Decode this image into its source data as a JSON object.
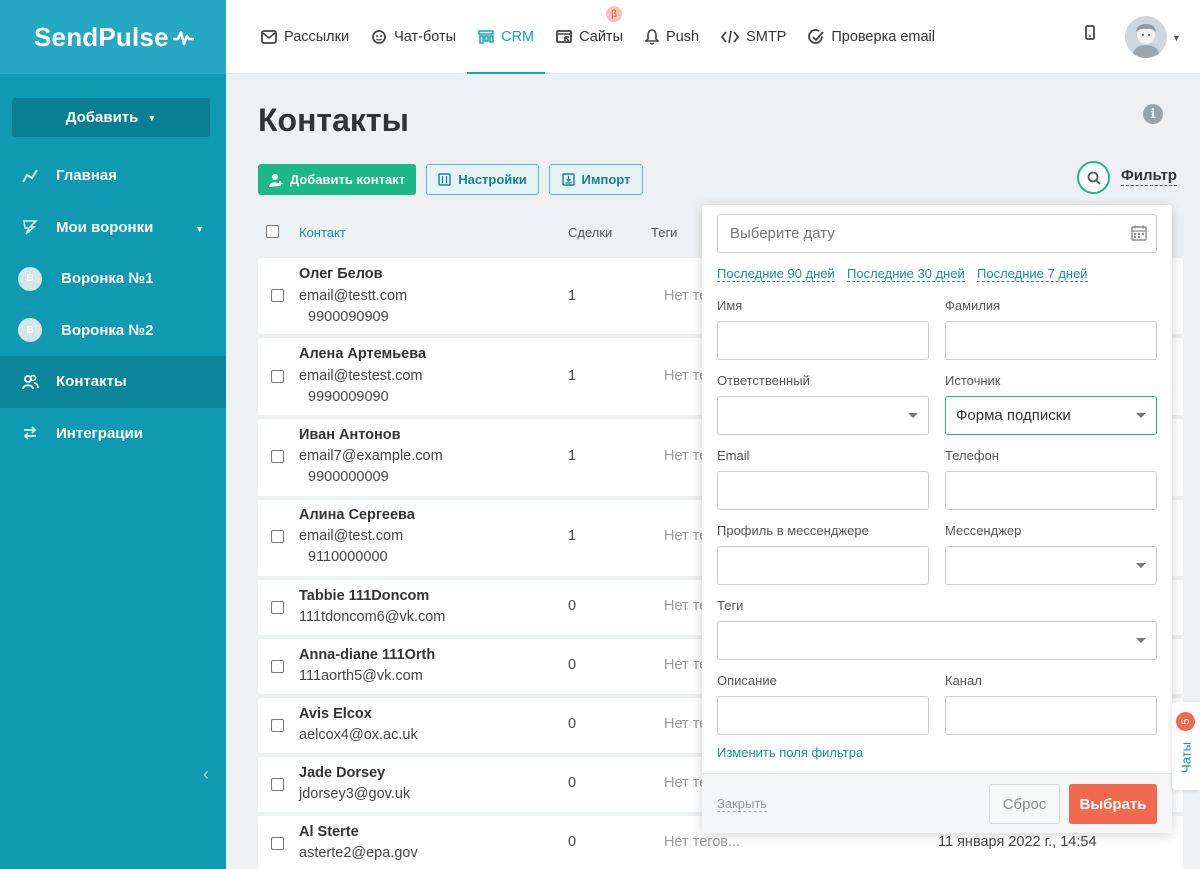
{
  "app": {
    "logo": "SendPulse"
  },
  "sidebar": {
    "add_button": "Добавить",
    "items": [
      {
        "label": "Главная",
        "icon": "chart-line-icon"
      },
      {
        "label": "Мои воронки",
        "icon": "funnel-icon"
      },
      {
        "label": "Воронка №1",
        "badge": "В"
      },
      {
        "label": "Воронка №2",
        "badge": "В"
      },
      {
        "label": "Контакты",
        "icon": "contacts-icon",
        "active": true
      },
      {
        "label": "Интеграции",
        "icon": "integrations-icon"
      }
    ]
  },
  "topnav": {
    "tabs": [
      {
        "label": "Рассылки",
        "icon": "mail-icon"
      },
      {
        "label": "Чат-боты",
        "icon": "chatbot-icon"
      },
      {
        "label": "CRM",
        "icon": "crm-icon",
        "active": true
      },
      {
        "label": "Сайты",
        "icon": "sites-icon",
        "badge": "β"
      },
      {
        "label": "Push",
        "icon": "bell-icon"
      },
      {
        "label": "SMTP",
        "icon": "code-icon"
      },
      {
        "label": "Проверка email",
        "icon": "check-circle-icon"
      }
    ]
  },
  "page": {
    "title": "Контакты",
    "add_contact": "Добавить контакт",
    "settings": "Настройки",
    "import": "Импорт",
    "filter": "Фильтр"
  },
  "table": {
    "headers": {
      "contact": "Контакт",
      "deals": "Сделки",
      "tags": "Теги"
    },
    "rows": [
      {
        "name": "Олег Белов",
        "email": "email@testt.com",
        "phone": "9900090909",
        "deals": "1",
        "tags": "Нет тегов..."
      },
      {
        "name": "Алена Артемьева",
        "email": "email@testest.com",
        "phone": "9990009090",
        "deals": "1",
        "tags": "Нет тегов..."
      },
      {
        "name": "Иван Антонов",
        "email": "email7@example.com",
        "phone": "9900000009",
        "deals": "1",
        "tags": "Нет тегов..."
      },
      {
        "name": "Алина Сергеева",
        "email": "email@test.com",
        "phone": "9110000000",
        "deals": "1",
        "tags": "Нет тегов..."
      },
      {
        "name": "Tabbie 111Doncom",
        "email": "111tdoncom6@vk.com",
        "phone": "",
        "deals": "0",
        "tags": "Нет тегов..."
      },
      {
        "name": "Anna-diane 111Orth",
        "email": "111aorth5@vk.com",
        "phone": "",
        "deals": "0",
        "tags": "Нет тегов..."
      },
      {
        "name": "Avis Elcox",
        "email": "aelcox4@ox.ac.uk",
        "phone": "",
        "deals": "0",
        "tags": "Нет тегов..."
      },
      {
        "name": "Jade Dorsey",
        "email": "jdorsey3@gov.uk",
        "phone": "",
        "deals": "0",
        "tags": "Нет тегов..."
      },
      {
        "name": "Al Sterte",
        "email": "asterte2@epa.gov",
        "phone": "",
        "deals": "0",
        "tags": "Нет тегов...",
        "date": "11 января 2022 г., 14:54"
      }
    ]
  },
  "filter_panel": {
    "date_placeholder": "Выберите дату",
    "quick": [
      "Последние 90 дней",
      "Последние 30 дней",
      "Последние 7 дней"
    ],
    "labels": {
      "first_name": "Имя",
      "last_name": "Фамилия",
      "responsible": "Ответственный",
      "source": "Источник",
      "email": "Email",
      "phone": "Телефон",
      "messenger_profile": "Профиль в мессенджере",
      "messenger": "Мессенджер",
      "tags": "Теги",
      "description": "Описание",
      "channel": "Канал"
    },
    "source_value": "Форма подписки",
    "edit_fields": "Изменить поля фильтра",
    "close": "Закрыть",
    "reset": "Сброс",
    "apply": "Выбрать"
  },
  "chats": {
    "label": "Чаты",
    "count": "5"
  },
  "colors": {
    "sidebar": "#0f9ab2",
    "accent": "#14a3c0",
    "green": "#1cb886",
    "apply": "#ef6a4e"
  }
}
